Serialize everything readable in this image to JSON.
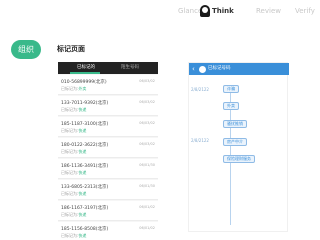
{
  "nav": {
    "items": [
      "Glance",
      "Think",
      "Review",
      "Verify"
    ]
  },
  "group_label": "组织",
  "page_title": "标记页面",
  "left_screen": {
    "tabs": [
      "已标记的",
      "陌生号码"
    ],
    "records": [
      {
        "number": "010-56899999(北京)",
        "tag_prefix": "已标记为:",
        "tag": "外卖",
        "time": "06/03/02"
      },
      {
        "number": "133-7011-9392(北京)",
        "tag_prefix": "已标记为:",
        "tag": "快递",
        "time": "06/03/02"
      },
      {
        "number": "185-1187-3100(北京)",
        "tag_prefix": "已标记为:",
        "tag": "快递",
        "time": "06/03/02"
      },
      {
        "number": "180-0122-3622(北京)",
        "tag_prefix": "已标记为:",
        "tag": "快递",
        "time": "06/03/02"
      },
      {
        "number": "186-1136-3491(北京)",
        "tag_prefix": "已标记为:",
        "tag": "快递",
        "time": "06/01/30"
      },
      {
        "number": "133-6805-2313(北京)",
        "tag_prefix": "已标记为:",
        "tag": "快递",
        "time": "06/01/30"
      },
      {
        "number": "186-1167-3197(北京)",
        "tag_prefix": "已标记为:",
        "tag": "快递",
        "time": "06/01/02"
      },
      {
        "number": "185-1156-8508(北京)",
        "tag_prefix": "已标记为:",
        "tag": "快递",
        "time": "06/01/02"
      }
    ]
  },
  "right_screen": {
    "back": "‹",
    "title": "已标记号码",
    "dates": [
      "2/8/2122",
      "2/8/2122"
    ],
    "chips": [
      "诈骗",
      "外卖",
      "骚扰推销",
      "房产中介",
      "保险理财服务"
    ]
  }
}
